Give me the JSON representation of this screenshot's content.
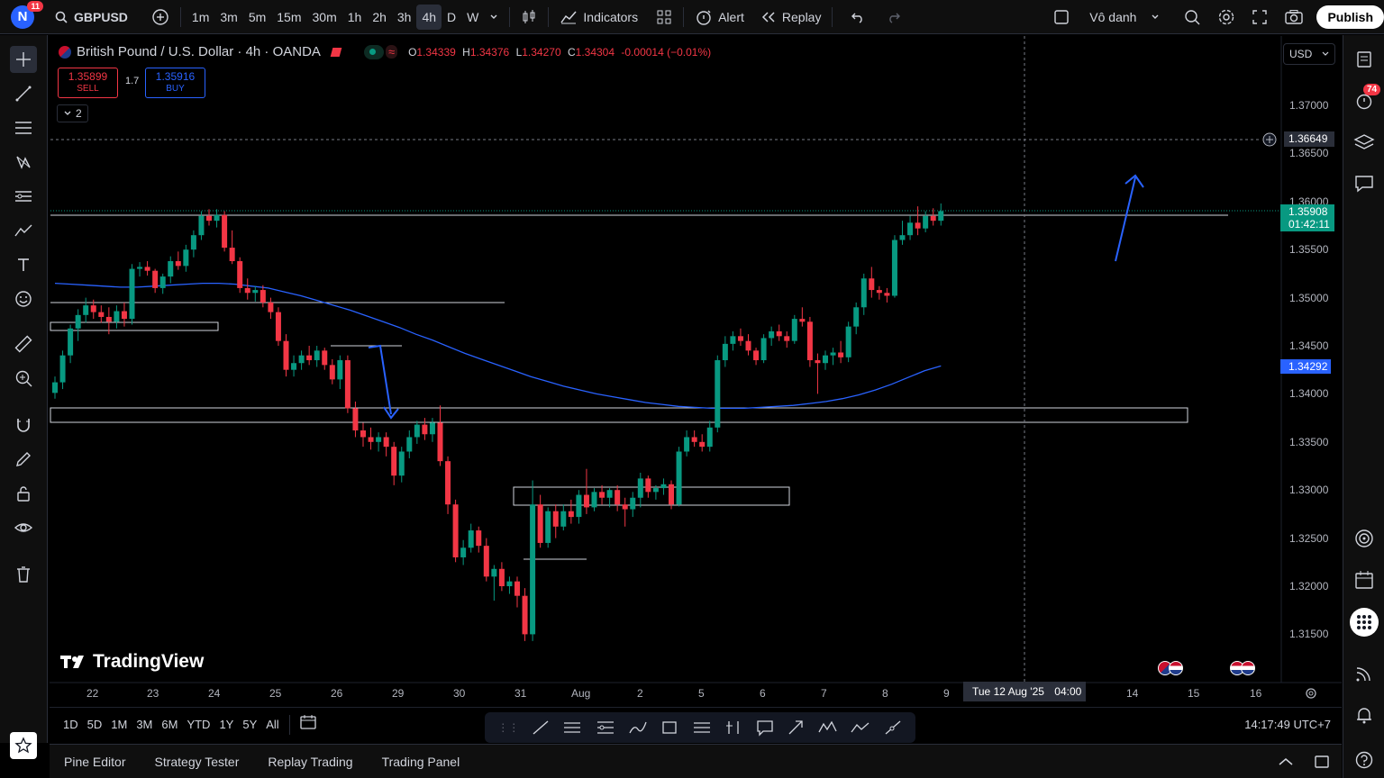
{
  "topbar": {
    "avatar_letter": "N",
    "notif_count": "11",
    "symbol": "GBPUSD",
    "intervals": [
      "1m",
      "3m",
      "5m",
      "15m",
      "30m",
      "1h",
      "2h",
      "3h",
      "4h",
      "D",
      "W"
    ],
    "active_interval": "4h",
    "indicators_label": "Indicators",
    "alert_label": "Alert",
    "replay_label": "Replay",
    "layout_name": "Vô danh",
    "publish_label": "Publish"
  },
  "legend": {
    "title": "British Pound / U.S. Dollar · 4h · OANDA",
    "o_label": "O",
    "o_val": "1.34339",
    "h_label": "H",
    "h_val": "1.34376",
    "l_label": "L",
    "l_val": "1.34270",
    "c_label": "C",
    "c_val": "1.34304",
    "change": "-0.00014 (−0.01%)",
    "sell_price": "1.35899",
    "sell_label": "SELL",
    "spread": "1.7",
    "buy_price": "1.35916",
    "buy_label": "BUY",
    "indicator_count": "2"
  },
  "currency": "USD",
  "price_axis": {
    "ticks": [
      "1.37000",
      "1.36500",
      "1.36000",
      "1.35500",
      "1.35000",
      "1.34500",
      "1.34000",
      "1.33500",
      "1.33000",
      "1.32500",
      "1.32000",
      "1.31500"
    ],
    "crosshair_price": "1.36649",
    "last_price": "1.35908",
    "countdown": "01:42:11",
    "ma_price": "1.34292"
  },
  "time_axis": {
    "labels": [
      "22",
      "23",
      "24",
      "25",
      "26",
      "29",
      "30",
      "31",
      "Aug",
      "2",
      "5",
      "6",
      "7",
      "8",
      "9",
      "14",
      "15",
      "16"
    ],
    "crosshair_label": "Tue 12 Aug '25",
    "crosshair_time": "04:00"
  },
  "watermark": "TradingView",
  "bottom": {
    "ranges": [
      "1D",
      "5D",
      "1M",
      "3M",
      "6M",
      "YTD",
      "1Y",
      "5Y",
      "All"
    ],
    "clock": "14:17:49 UTC+7"
  },
  "panel_tabs": [
    "Pine Editor",
    "Strategy Tester",
    "Replay Trading",
    "Trading Panel"
  ],
  "right_badge": "74",
  "colors": {
    "up": "#089981",
    "down": "#f23645",
    "ma": "#2962ff",
    "accent": "#2962ff"
  },
  "chart_data": {
    "type": "candlestick",
    "symbol": "GBPUSD",
    "interval": "4h",
    "ylim": [
      1.3125,
      1.3735
    ],
    "candles": [
      [
        1.3401,
        1.3418,
        1.3395,
        1.3412
      ],
      [
        1.3412,
        1.3445,
        1.3405,
        1.344
      ],
      [
        1.344,
        1.3472,
        1.3432,
        1.3468
      ],
      [
        1.3468,
        1.3488,
        1.3455,
        1.3482
      ],
      [
        1.3482,
        1.35,
        1.3474,
        1.3492
      ],
      [
        1.3492,
        1.3498,
        1.3478,
        1.3485
      ],
      [
        1.3485,
        1.3492,
        1.3474,
        1.348
      ],
      [
        1.348,
        1.349,
        1.3462,
        1.3475
      ],
      [
        1.3475,
        1.3492,
        1.3468,
        1.3486
      ],
      [
        1.3486,
        1.3495,
        1.347,
        1.3478
      ],
      [
        1.3478,
        1.3535,
        1.3472,
        1.353
      ],
      [
        1.353,
        1.3537,
        1.3522,
        1.3532
      ],
      [
        1.3532,
        1.3538,
        1.3523,
        1.3528
      ],
      [
        1.3528,
        1.353,
        1.3505,
        1.351
      ],
      [
        1.351,
        1.3525,
        1.3504,
        1.3522
      ],
      [
        1.3522,
        1.3543,
        1.3515,
        1.3538
      ],
      [
        1.3538,
        1.3548,
        1.3529,
        1.3533
      ],
      [
        1.3533,
        1.3555,
        1.3527,
        1.355
      ],
      [
        1.355,
        1.357,
        1.3542,
        1.3565
      ],
      [
        1.3565,
        1.359,
        1.356,
        1.3585
      ],
      [
        1.3585,
        1.3592,
        1.3575,
        1.358
      ],
      [
        1.358,
        1.3592,
        1.3573,
        1.3586
      ],
      [
        1.3586,
        1.359,
        1.3548,
        1.3552
      ],
      [
        1.3552,
        1.357,
        1.3535,
        1.3538
      ],
      [
        1.3538,
        1.3542,
        1.3505,
        1.351
      ],
      [
        1.351,
        1.352,
        1.3498,
        1.3505
      ],
      [
        1.3505,
        1.3512,
        1.3496,
        1.3508
      ],
      [
        1.3508,
        1.3513,
        1.349,
        1.3495
      ],
      [
        1.3495,
        1.35,
        1.3478,
        1.3485
      ],
      [
        1.3485,
        1.349,
        1.345,
        1.3455
      ],
      [
        1.3455,
        1.3462,
        1.3418,
        1.3425
      ],
      [
        1.3425,
        1.344,
        1.3418,
        1.3432
      ],
      [
        1.3432,
        1.3445,
        1.3425,
        1.344
      ],
      [
        1.344,
        1.345,
        1.343,
        1.3435
      ],
      [
        1.3435,
        1.345,
        1.3428,
        1.3445
      ],
      [
        1.3445,
        1.3448,
        1.3425,
        1.343
      ],
      [
        1.343,
        1.3436,
        1.341,
        1.3415
      ],
      [
        1.3415,
        1.344,
        1.3405,
        1.3435
      ],
      [
        1.3435,
        1.344,
        1.338,
        1.3385
      ],
      [
        1.3385,
        1.3392,
        1.3355,
        1.3362
      ],
      [
        1.3362,
        1.337,
        1.3345,
        1.3355
      ],
      [
        1.3355,
        1.3365,
        1.3342,
        1.335
      ],
      [
        1.335,
        1.336,
        1.334,
        1.3355
      ],
      [
        1.3355,
        1.336,
        1.3335,
        1.3345
      ],
      [
        1.3345,
        1.335,
        1.3305,
        1.3315
      ],
      [
        1.3315,
        1.3345,
        1.3308,
        1.334
      ],
      [
        1.334,
        1.3362,
        1.3333,
        1.3355
      ],
      [
        1.3355,
        1.3372,
        1.3348,
        1.3368
      ],
      [
        1.3368,
        1.3375,
        1.3352,
        1.3358
      ],
      [
        1.3358,
        1.3375,
        1.335,
        1.337
      ],
      [
        1.337,
        1.3388,
        1.3325,
        1.333
      ],
      [
        1.333,
        1.3335,
        1.3275,
        1.3285
      ],
      [
        1.3285,
        1.329,
        1.3225,
        1.323
      ],
      [
        1.323,
        1.3248,
        1.3222,
        1.324
      ],
      [
        1.324,
        1.3265,
        1.3235,
        1.3258
      ],
      [
        1.3258,
        1.3262,
        1.3235,
        1.3242
      ],
      [
        1.3242,
        1.325,
        1.3205,
        1.321
      ],
      [
        1.321,
        1.3222,
        1.3185,
        1.3218
      ],
      [
        1.3218,
        1.3225,
        1.3195,
        1.32
      ],
      [
        1.32,
        1.321,
        1.3192,
        1.3205
      ],
      [
        1.3205,
        1.321,
        1.3178,
        1.319
      ],
      [
        1.319,
        1.3198,
        1.3143,
        1.315
      ],
      [
        1.315,
        1.331,
        1.3143,
        1.3285
      ],
      [
        1.3285,
        1.3295,
        1.324,
        1.3245
      ],
      [
        1.3245,
        1.3282,
        1.324,
        1.3278
      ],
      [
        1.3278,
        1.3285,
        1.325,
        1.3262
      ],
      [
        1.3262,
        1.3285,
        1.3258,
        1.3278
      ],
      [
        1.3278,
        1.329,
        1.3265,
        1.3272
      ],
      [
        1.3272,
        1.33,
        1.3265,
        1.3295
      ],
      [
        1.3295,
        1.3322,
        1.3275,
        1.3282
      ],
      [
        1.3282,
        1.3302,
        1.3278,
        1.3298
      ],
      [
        1.3298,
        1.3305,
        1.3285,
        1.3292
      ],
      [
        1.3292,
        1.3302,
        1.3282,
        1.33
      ],
      [
        1.33,
        1.3305,
        1.3278,
        1.3285
      ],
      [
        1.3285,
        1.3292,
        1.3262,
        1.328
      ],
      [
        1.328,
        1.3298,
        1.3272,
        1.3292
      ],
      [
        1.3292,
        1.3318,
        1.3282,
        1.3312
      ],
      [
        1.3312,
        1.3315,
        1.3292,
        1.3298
      ],
      [
        1.3298,
        1.3305,
        1.329,
        1.3302
      ],
      [
        1.3302,
        1.3312,
        1.3295,
        1.3306
      ],
      [
        1.3306,
        1.331,
        1.328,
        1.3285
      ],
      [
        1.3285,
        1.3345,
        1.3283,
        1.334
      ],
      [
        1.334,
        1.3362,
        1.3335,
        1.3355
      ],
      [
        1.3355,
        1.3362,
        1.3345,
        1.335
      ],
      [
        1.335,
        1.3358,
        1.334,
        1.3345
      ],
      [
        1.3345,
        1.3372,
        1.334,
        1.3365
      ],
      [
        1.3365,
        1.344,
        1.336,
        1.3435
      ],
      [
        1.3435,
        1.346,
        1.3428,
        1.3452
      ],
      [
        1.3452,
        1.3465,
        1.3445,
        1.346
      ],
      [
        1.346,
        1.3468,
        1.345,
        1.3455
      ],
      [
        1.3455,
        1.3462,
        1.344,
        1.3445
      ],
      [
        1.3445,
        1.3448,
        1.343,
        1.3435
      ],
      [
        1.3435,
        1.3462,
        1.3432,
        1.3458
      ],
      [
        1.3458,
        1.347,
        1.345,
        1.3465
      ],
      [
        1.3465,
        1.3472,
        1.3455,
        1.346
      ],
      [
        1.346,
        1.3465,
        1.3448,
        1.3455
      ],
      [
        1.3455,
        1.3482,
        1.3452,
        1.3478
      ],
      [
        1.3478,
        1.349,
        1.347,
        1.3475
      ],
      [
        1.3475,
        1.348,
        1.3428,
        1.3435
      ],
      [
        1.3435,
        1.3442,
        1.34,
        1.3432
      ],
      [
        1.3432,
        1.3445,
        1.3425,
        1.344
      ],
      [
        1.344,
        1.3448,
        1.343,
        1.3443
      ],
      [
        1.3443,
        1.3455,
        1.3432,
        1.3438
      ],
      [
        1.3438,
        1.3475,
        1.3433,
        1.347
      ],
      [
        1.347,
        1.3495,
        1.3462,
        1.349
      ],
      [
        1.349,
        1.3525,
        1.3482,
        1.352
      ],
      [
        1.352,
        1.3532,
        1.35,
        1.3508
      ],
      [
        1.3508,
        1.3512,
        1.3498,
        1.3505
      ],
      [
        1.3505,
        1.351,
        1.3495,
        1.3502
      ],
      [
        1.3502,
        1.3565,
        1.35,
        1.356
      ],
      [
        1.356,
        1.358,
        1.3555,
        1.3565
      ],
      [
        1.3565,
        1.3585,
        1.356,
        1.3578
      ],
      [
        1.3578,
        1.3595,
        1.3565,
        1.3572
      ],
      [
        1.3572,
        1.359,
        1.3568,
        1.3585
      ],
      [
        1.3585,
        1.3593,
        1.3575,
        1.358
      ],
      [
        1.358,
        1.3598,
        1.3575,
        1.359
      ]
    ],
    "moving_average": [
      1.3515,
      1.3514,
      1.3513,
      1.3512,
      1.3511,
      1.3511,
      1.3512,
      1.3513,
      1.3514,
      1.3515,
      1.3515,
      1.3514,
      1.3512,
      1.351,
      1.3506,
      1.3502,
      1.3497,
      1.3492,
      1.3487,
      1.3481,
      1.3475,
      1.3469,
      1.3462,
      1.3456,
      1.3449,
      1.3442,
      1.3436,
      1.343,
      1.3424,
      1.3418,
      1.3413,
      1.3408,
      1.3404,
      1.34,
      1.3397,
      1.3394,
      1.3391,
      1.3389,
      1.3387,
      1.3386,
      1.3385,
      1.3385,
      1.3385,
      1.3386,
      1.3387,
      1.3388,
      1.339,
      1.3392,
      1.3395,
      1.3399,
      1.3404,
      1.341,
      1.3417,
      1.3424,
      1.3429
    ],
    "horizontal_lines": [
      1.3591,
      1.3665
    ]
  }
}
